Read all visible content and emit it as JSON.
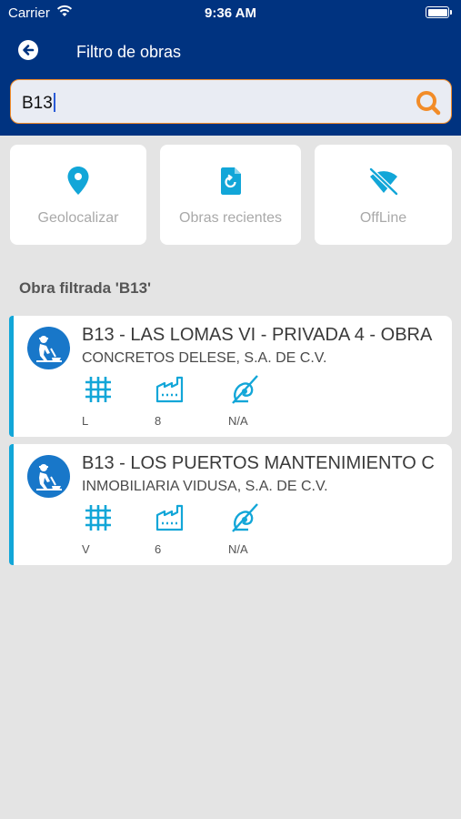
{
  "status_bar": {
    "carrier": "Carrier",
    "time": "9:36 AM"
  },
  "header": {
    "title": "Filtro de obras"
  },
  "search": {
    "value": "B13"
  },
  "quick_actions": [
    {
      "label": "Geolocalizar",
      "icon": "location-pin-icon"
    },
    {
      "label": "Obras recientes",
      "icon": "recent-document-icon"
    },
    {
      "label": "OffLine",
      "icon": "wifi-off-icon"
    }
  ],
  "section_title": "Obra filtrada 'B13'",
  "results": [
    {
      "title": "B13 - LAS LOMAS VI - PRIVADA 4 - OBRA",
      "company": "CONCRETOS DELESE, S.A. DE C.V.",
      "grid_value": "L",
      "factory_value": "8",
      "pump_value": "N/A"
    },
    {
      "title": "B13 - LOS PUERTOS MANTENIMIENTO C",
      "company": "INMOBILIARIA VIDUSA, S.A. DE C.V.",
      "grid_value": "V",
      "factory_value": "6",
      "pump_value": "N/A"
    }
  ],
  "colors": {
    "header": "#003380",
    "accent": "#12a6d8",
    "search_border": "#f28c28",
    "avatar": "#1877c9",
    "background": "#e4e4e4"
  }
}
